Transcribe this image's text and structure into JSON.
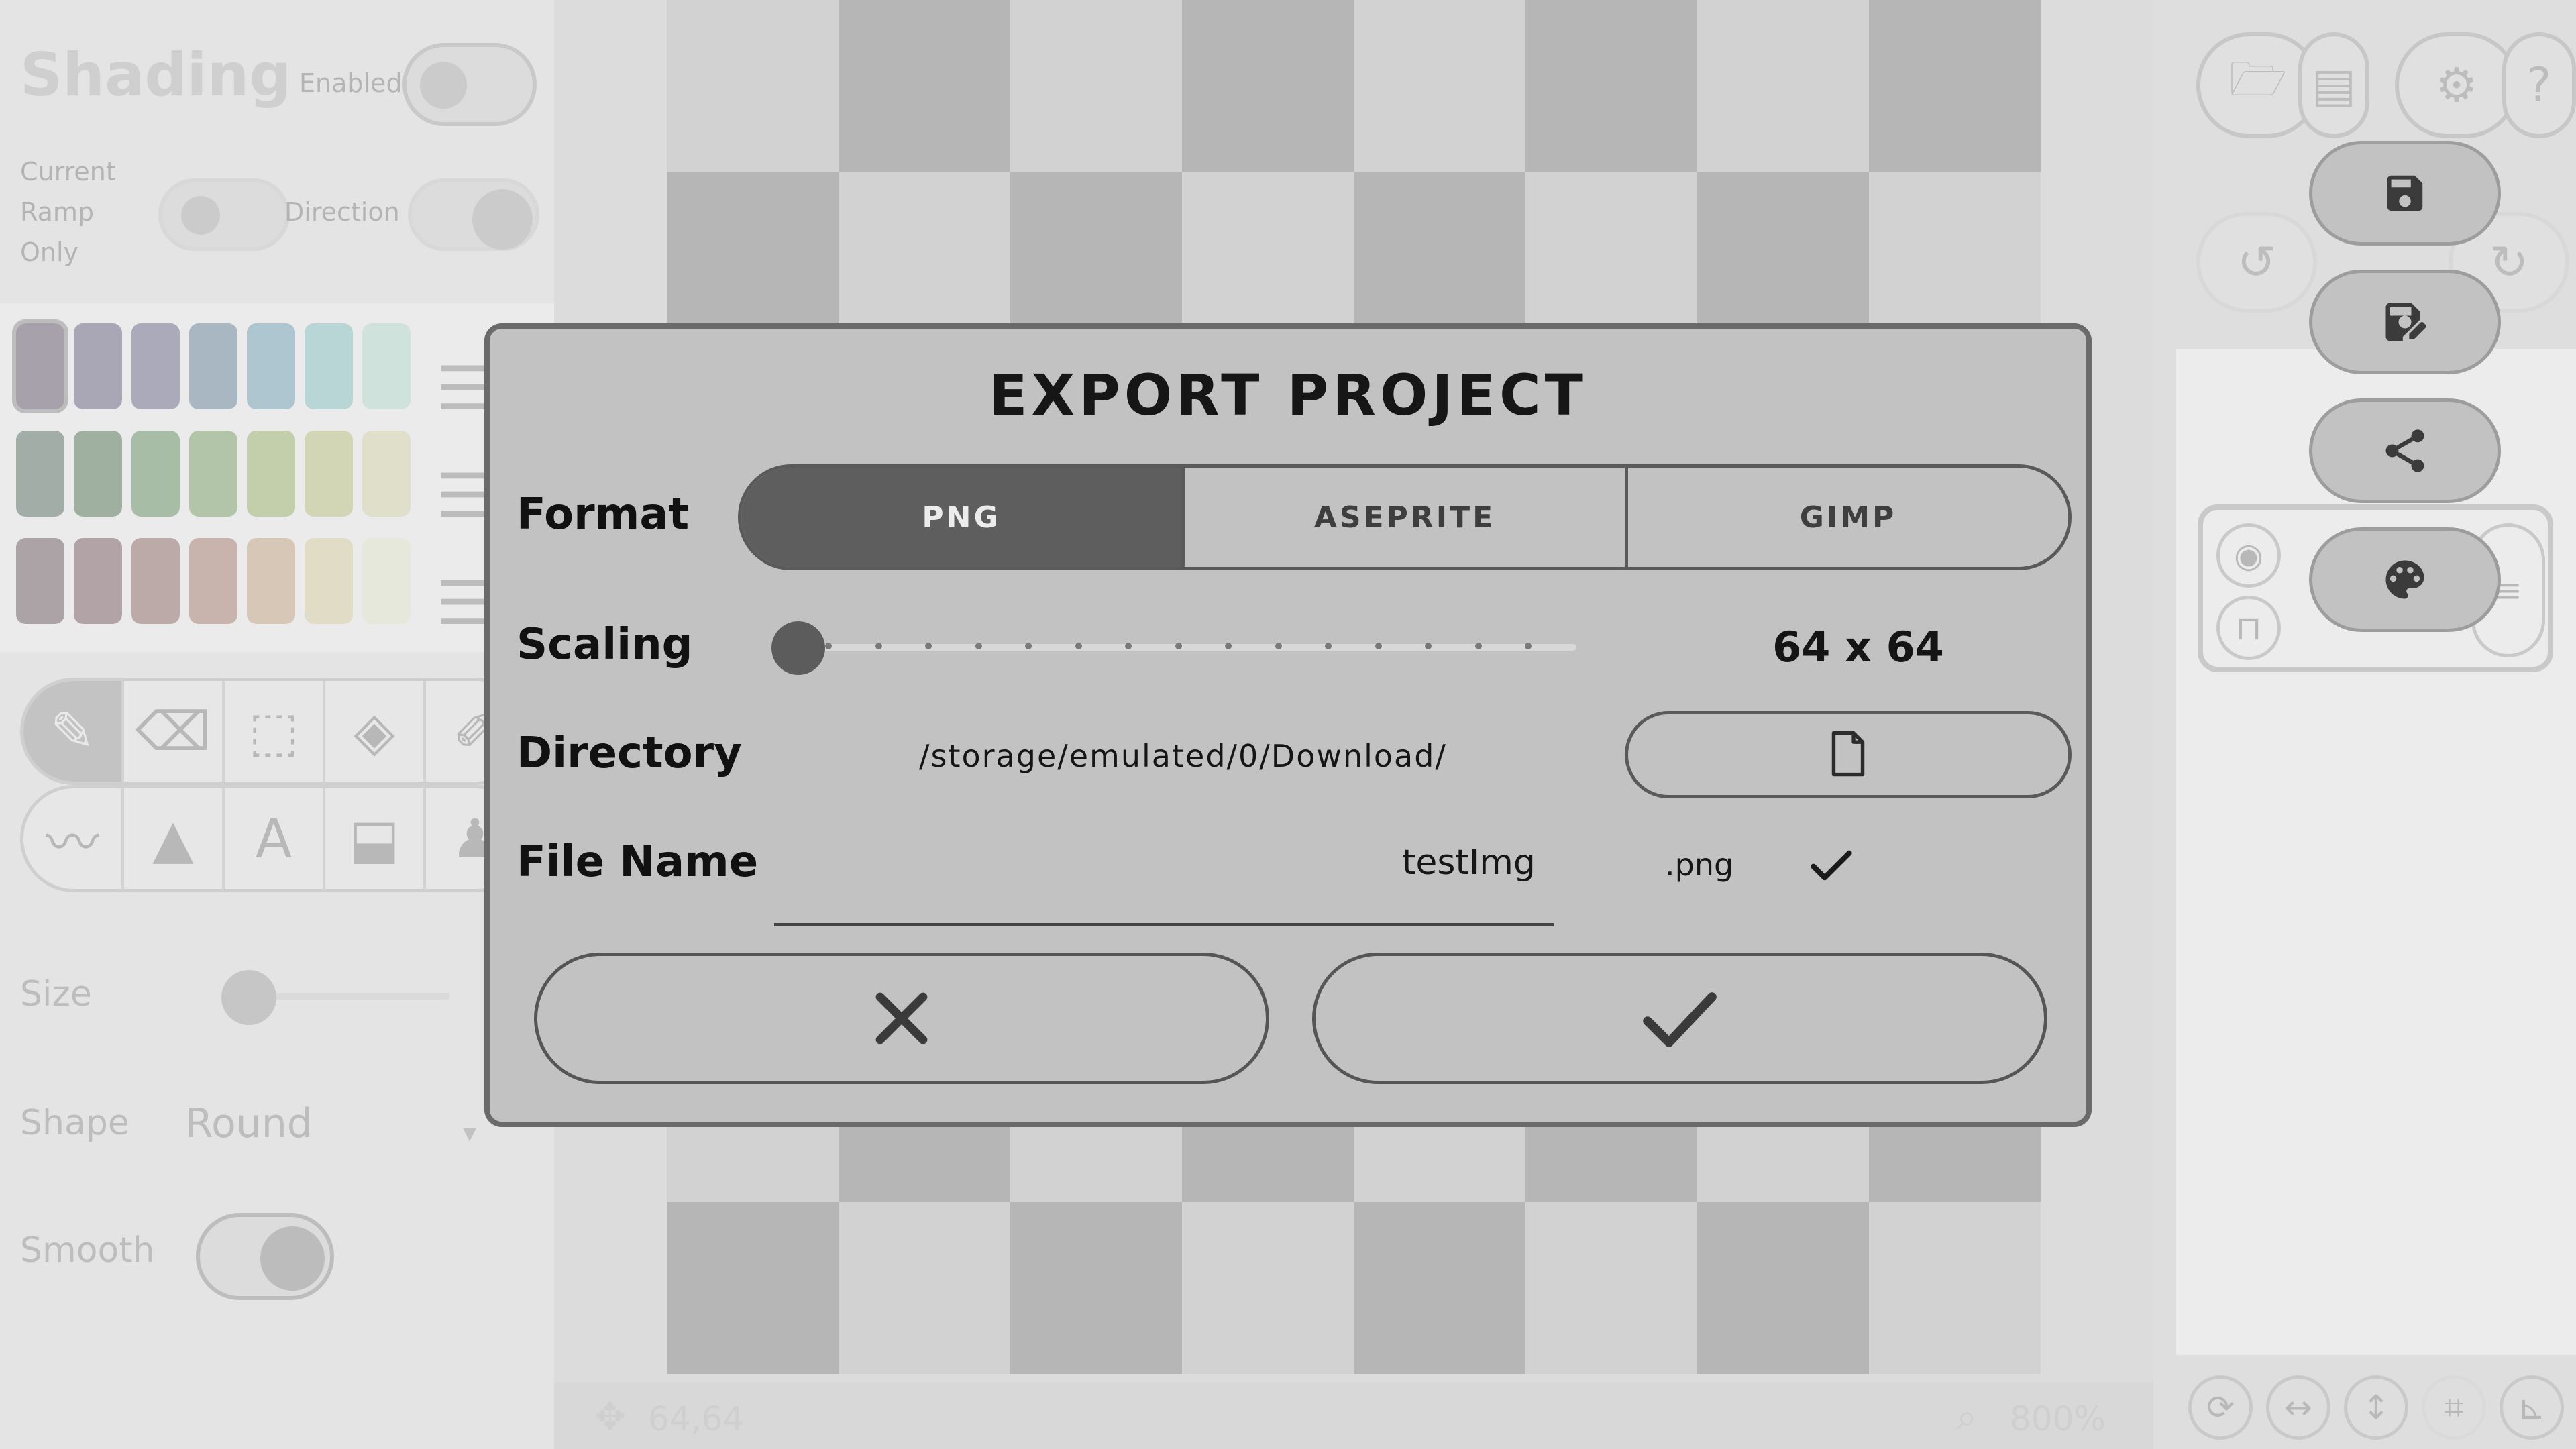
{
  "left_panel": {
    "title": "Shading",
    "enabled_label": "Enabled",
    "current_ramp_label": "Current\nRamp\nOnly",
    "direction_label": "Direction",
    "size_label": "Size",
    "shape_label": "Shape",
    "shape_value": "Round",
    "smooth_label": "Smooth",
    "palette_rows": [
      [
        "#a7a1ab",
        "#a9a7b5",
        "#aaaabb",
        "#a9b7c3",
        "#adc6cf",
        "#b8d6d6",
        "#cfe3dc"
      ],
      [
        "#a1ada6",
        "#9fb0a0",
        "#a7bda5",
        "#b2c5a8",
        "#c3cfab",
        "#d2d6b4",
        "#e0dfc9"
      ],
      [
        "#aca3a6",
        "#b2a3a6",
        "#bcaaa9",
        "#c8b3ad",
        "#d6c7b7",
        "#e0dcc6",
        "#e6e8dc"
      ]
    ],
    "tools_row1": [
      "pencil-icon",
      "eraser-icon",
      "select-icon",
      "fill-icon",
      "picker-icon"
    ],
    "tools_row2": [
      "shading-icon",
      "shapes-icon",
      "text-icon",
      "color-replace-icon",
      "stamp-icon"
    ]
  },
  "status_bar": {
    "cursor_position": "64,64",
    "zoom": "800%"
  },
  "dialog": {
    "title": "EXPORT PROJECT",
    "format_label": "Format",
    "format_options": [
      "PNG",
      "ASEPRITE",
      "GIMP"
    ],
    "format_selected": "PNG",
    "scaling_label": "Scaling",
    "scaling_value": "64 x 64",
    "scaling_level": 0,
    "directory_label": "Directory",
    "directory_path": "/storage/emulated/0/Download/",
    "file_name_label": "File Name",
    "file_name_value": "testImg",
    "file_extension": ".png",
    "cancel_icon": "close-icon",
    "confirm_icon": "check-icon"
  },
  "colors": {
    "dialog_bg": "#c2c2c2",
    "accent_dark": "#5e5e5e",
    "checker_dark": "#b6b6b6",
    "checker_light": "#d2d2d2"
  }
}
